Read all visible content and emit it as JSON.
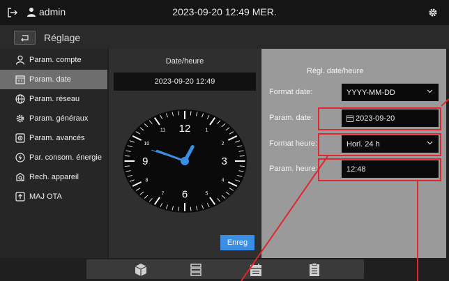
{
  "topbar": {
    "username": "admin",
    "datetime": "2023-09-20 12:49 MER.",
    "icons": [
      "exit-icon",
      "user-icon",
      "gear-icon"
    ]
  },
  "header": {
    "back_icon": "back-arrow-icon",
    "title": "Réglage"
  },
  "sidebar": {
    "items": [
      {
        "label": "Param. compte",
        "icon": "user-icon"
      },
      {
        "label": "Param. date",
        "icon": "calendar-icon",
        "active": true
      },
      {
        "label": "Param. réseau",
        "icon": "globe-icon"
      },
      {
        "label": "Param. généraux",
        "icon": "gear-icon"
      },
      {
        "label": "Param. avancés",
        "icon": "advanced-settings-icon"
      },
      {
        "label": "Par. consom. énergie",
        "icon": "energy-icon"
      },
      {
        "label": "Rech. appareil",
        "icon": "device-search-icon"
      },
      {
        "label": "MAJ OTA",
        "icon": "upload-icon"
      }
    ]
  },
  "datetime_panel": {
    "title": "Date/heure",
    "display": "2023-09-20 12:49",
    "clock": {
      "hour": 12,
      "minute": 49,
      "numbers": [
        "12",
        "1",
        "2",
        "3",
        "4",
        "5",
        "6",
        "7",
        "8",
        "9",
        "10",
        "11"
      ]
    },
    "save_label": "Enreg"
  },
  "settings_panel": {
    "title": "Régl. date/heure",
    "fields": {
      "date_format": {
        "label": "Format date:",
        "value": "YYYY-MM-DD"
      },
      "date": {
        "label": "Param. date:",
        "value": "2023-09-20"
      },
      "hour_format": {
        "label": "Format heure:",
        "value": "Horl. 24 h"
      },
      "time": {
        "label": "Param. heure:",
        "value": "12:48"
      }
    }
  },
  "dock": {
    "icons": [
      "box-icon",
      "layers-icon",
      "calendar-icon",
      "document-icon"
    ]
  },
  "colors": {
    "accent": "#3a8ee6",
    "highlight": "#e0262e",
    "active_menu": "#6e6e6e"
  }
}
